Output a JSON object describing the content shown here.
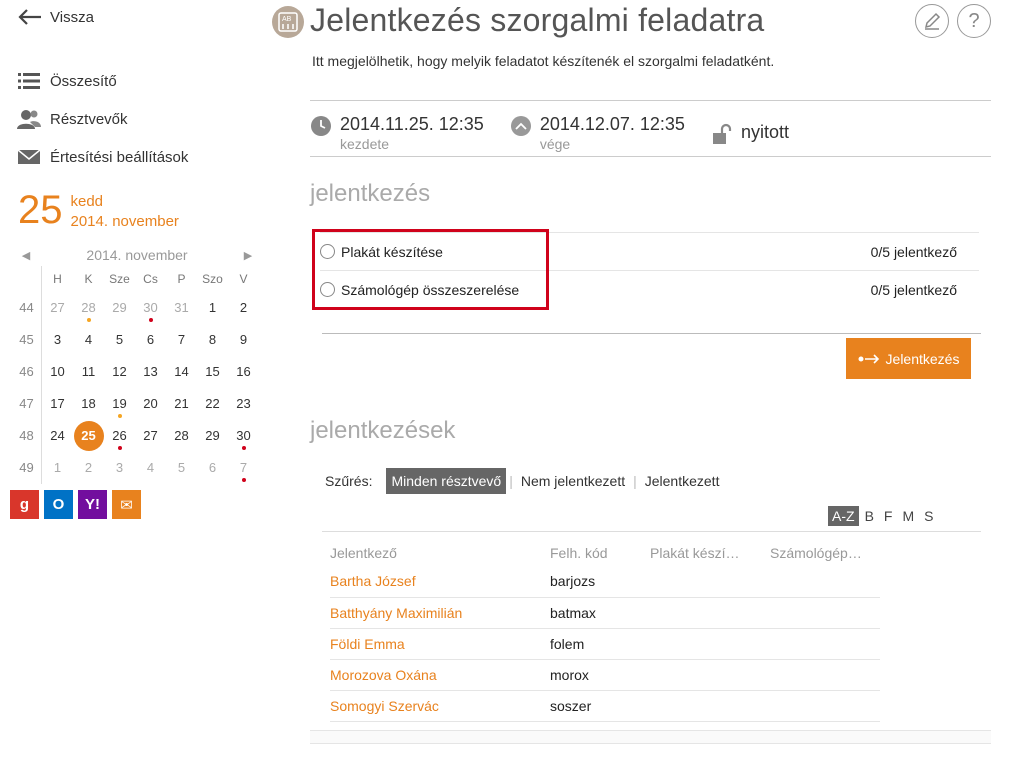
{
  "sidebar": {
    "back_label": "Vissza",
    "nav": [
      {
        "label": "Összesítő",
        "icon": "list-icon"
      },
      {
        "label": "Résztvevők",
        "icon": "people-icon"
      },
      {
        "label": "Értesítési beállítások",
        "icon": "envelope-icon"
      }
    ],
    "today": {
      "day": "25",
      "weekday": "kedd",
      "month": "2014. november"
    },
    "calendar": {
      "month_label": "2014. november",
      "headers": [
        "H",
        "K",
        "Sze",
        "Cs",
        "P",
        "Szo",
        "V"
      ],
      "weeks": [
        {
          "week": "44",
          "days": [
            "27",
            "28",
            "29",
            "30",
            "31",
            "1",
            "2"
          ]
        },
        {
          "week": "45",
          "days": [
            "3",
            "4",
            "5",
            "6",
            "7",
            "8",
            "9"
          ]
        },
        {
          "week": "46",
          "days": [
            "10",
            "11",
            "12",
            "13",
            "14",
            "15",
            "16"
          ]
        },
        {
          "week": "47",
          "days": [
            "17",
            "18",
            "19",
            "20",
            "21",
            "22",
            "23"
          ]
        },
        {
          "week": "48",
          "days": [
            "24",
            "25",
            "26",
            "27",
            "28",
            "29",
            "30"
          ]
        },
        {
          "week": "49",
          "days": [
            "1",
            "2",
            "3",
            "4",
            "5",
            "6",
            "7"
          ]
        }
      ]
    },
    "exports": [
      {
        "label": "g",
        "color": "#d9362b",
        "icon": "google-icon"
      },
      {
        "label": "O",
        "color": "#0072c6",
        "icon": "outlook-icon"
      },
      {
        "label": "Y!",
        "color": "#720e9e",
        "icon": "yahoo-icon"
      },
      {
        "label": "✉",
        "color": "#e8821e",
        "icon": "mail-icon"
      }
    ]
  },
  "header": {
    "title": "Jelentkezés szorgalmi feladatra",
    "description": "Itt megjelölhetik, hogy melyik feladatot készítenék el szorgalmi feladatként."
  },
  "info": {
    "start": {
      "value": "2014.11.25. 12:35",
      "label": "kezdete"
    },
    "end": {
      "value": "2014.12.07. 12:35",
      "label": "vége"
    },
    "status": "nyitott"
  },
  "signup": {
    "section_title": "jelentkezés",
    "options": [
      {
        "label": "Plakát készítése",
        "count": "0/5 jelentkező"
      },
      {
        "label": "Számológép összeszerelése",
        "count": "0/5 jelentkező"
      }
    ],
    "button_label": "Jelentkezés"
  },
  "signups": {
    "section_title": "jelentkezések",
    "filter_label": "Szűrés:",
    "filters": [
      "Minden résztvevő",
      "Nem jelentkezett",
      "Jelentkezett"
    ],
    "alpha": [
      "A-Z",
      "B",
      "F",
      "M",
      "S"
    ],
    "columns": [
      "Jelentkező",
      "Felh. kód",
      "Plakát készí…",
      "Számológép…"
    ],
    "rows": [
      {
        "name": "Bartha József",
        "code": "barjozs"
      },
      {
        "name": "Batthyány Maximilián",
        "code": "batmax"
      },
      {
        "name": "Földi Emma",
        "code": "folem"
      },
      {
        "name": "Morozova Oxána",
        "code": "morox"
      },
      {
        "name": "Somogyi Szervác",
        "code": "soszer"
      }
    ]
  },
  "colors": {
    "accent": "#e8821e",
    "highlight": "#d0021b"
  }
}
